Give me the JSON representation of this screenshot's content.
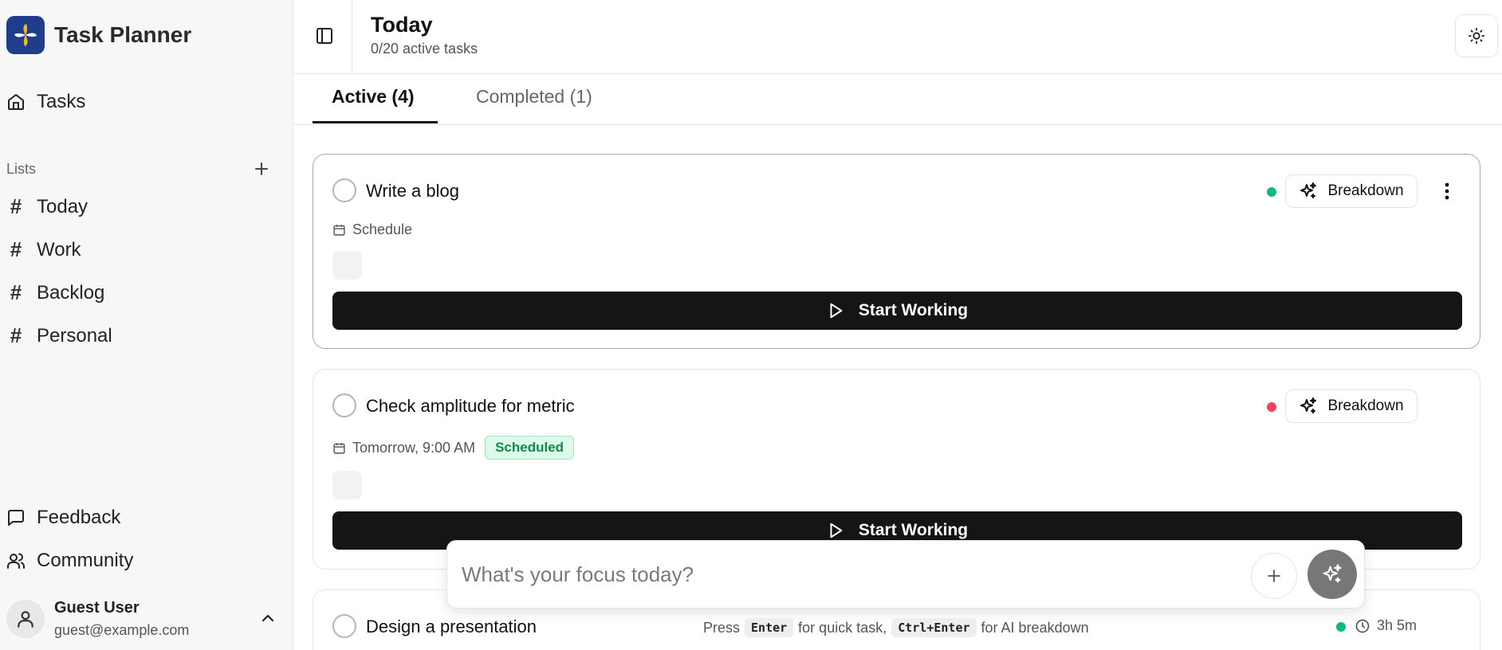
{
  "app": {
    "name": "Task Planner"
  },
  "sidebar": {
    "main_item": {
      "label": "Tasks"
    },
    "lists_label": "Lists",
    "lists": [
      {
        "label": "Today"
      },
      {
        "label": "Work"
      },
      {
        "label": "Backlog"
      },
      {
        "label": "Personal"
      }
    ],
    "footer_items": [
      {
        "label": "Feedback"
      },
      {
        "label": "Community"
      }
    ],
    "user": {
      "name": "Guest User",
      "email": "guest@example.com"
    }
  },
  "header": {
    "title": "Today",
    "subtitle": "0/20 active tasks"
  },
  "tabs": [
    {
      "label": "Active (4)"
    },
    {
      "label": "Completed (1)"
    }
  ],
  "tasks": [
    {
      "title": "Write a blog",
      "schedule": "Schedule",
      "priority_color": "#10b981",
      "breakdown_label": "Breakdown",
      "start_label": "Start Working"
    },
    {
      "title": "Check amplitude for metric",
      "schedule": "Tomorrow, 9:00 AM",
      "status": "Scheduled",
      "priority_color": "#f43f5e",
      "breakdown_label": "Breakdown",
      "start_label": "Start Working"
    },
    {
      "title": "Design a presentation",
      "priority_color": "#10b981",
      "duration": "3h 5m"
    }
  ],
  "quick_add": {
    "placeholder": "What's your focus today?",
    "hint": {
      "press": "Press",
      "key1": "Enter",
      "text1": "for quick task,",
      "key2": "Ctrl+Enter",
      "text2": "for AI breakdown"
    }
  },
  "icons": {
    "home": "home-icon",
    "plus": "plus-icon",
    "feedback": "message-square-icon",
    "community": "users-icon",
    "user": "user-icon",
    "chevron": "chevron-up-icon",
    "sidebar_toggle": "panel-left-icon",
    "theme": "sun-icon",
    "calendar": "calendar-icon",
    "sparkles": "sparkles-icon",
    "more": "more-vertical-icon",
    "play": "play-icon",
    "clock": "clock-icon"
  },
  "colors": {
    "logo_bg": "#1f3d8a",
    "logo_accent": "#f5b921",
    "primary_button": "#151515",
    "scheduled_badge": "#0e8a50"
  }
}
